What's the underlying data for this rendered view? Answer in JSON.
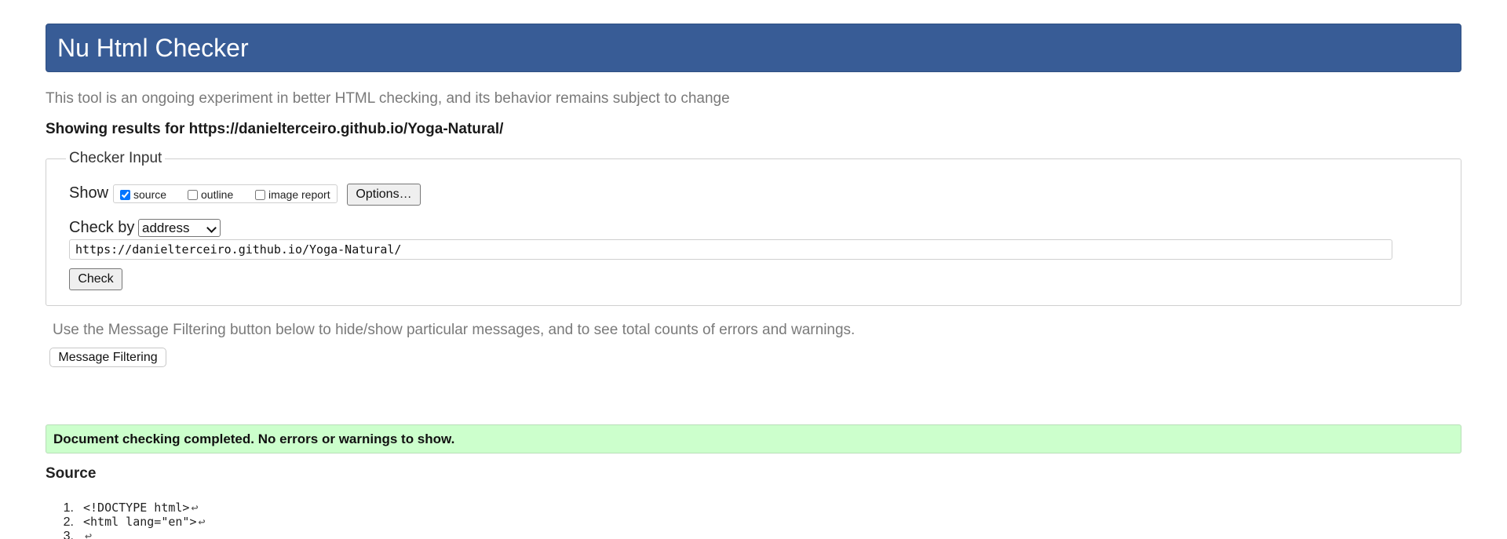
{
  "header": {
    "title": "Nu Html Checker"
  },
  "intro": {
    "text": "This tool is an ongoing experiment in better HTML checking, and its behavior remains subject to change"
  },
  "results": {
    "heading": "Showing results for https://danielterceiro.github.io/Yoga-Natural/"
  },
  "checker": {
    "legend": "Checker Input",
    "show_label": "Show",
    "options": [
      {
        "label": "source",
        "checked": true
      },
      {
        "label": "outline",
        "checked": false
      },
      {
        "label": "image report",
        "checked": false
      }
    ],
    "options_button": "Options…",
    "checkby_label": "Check by",
    "checkby_value": "address",
    "url_value": "https://danielterceiro.github.io/Yoga-Natural/",
    "check_button": "Check"
  },
  "filtering": {
    "text": "Use the Message Filtering button below to hide/show particular messages, and to see total counts of errors and warnings.",
    "button": "Message Filtering"
  },
  "status": {
    "message": "Document checking completed. No errors or warnings to show.",
    "color": "#ccffcc"
  },
  "source": {
    "heading": "Source",
    "lines": [
      {
        "num": "1.",
        "code": "<!DOCTYPE html>",
        "lf": "↩"
      },
      {
        "num": "2.",
        "code": "<html lang=\"en\">",
        "lf": "↩"
      },
      {
        "num": "3.",
        "code": "",
        "lf": "↩"
      }
    ]
  },
  "colors": {
    "header_bg": "#385c96",
    "muted_text": "#7a7a7a"
  }
}
